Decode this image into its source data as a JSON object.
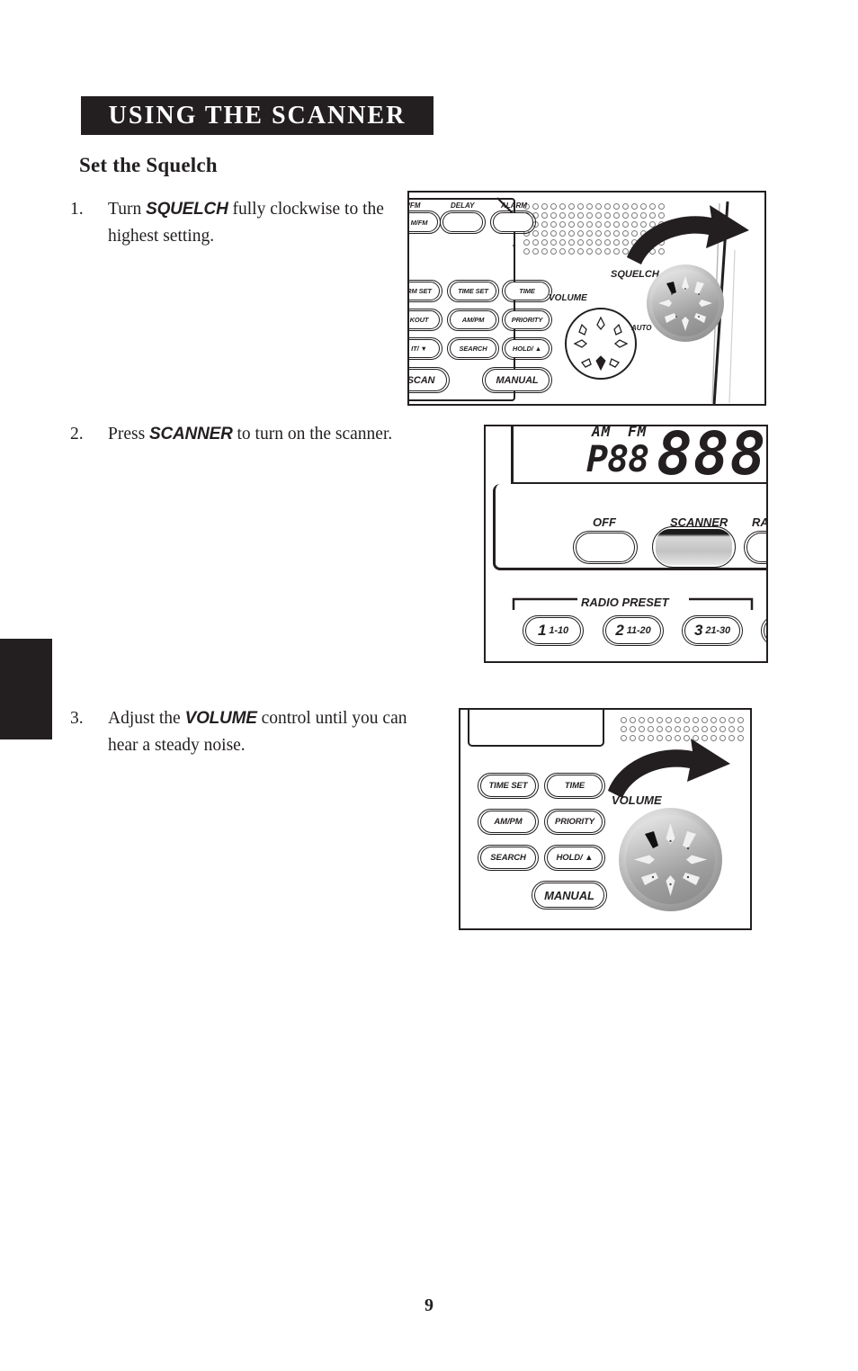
{
  "page": {
    "chapter_title": "USING THE SCANNER",
    "section_heading": "Set the Squelch",
    "page_number": "9"
  },
  "steps": [
    {
      "number": "1.",
      "text_before": "Turn ",
      "keyword": "SQUELCH",
      "text_after": " fully clockwise to the highest setting."
    },
    {
      "number": "2.",
      "text_before": "Press ",
      "keyword": "SCANNER",
      "text_after": " to turn on the scanner."
    },
    {
      "number": "3.",
      "text_before": "Adjust the ",
      "keyword": "VOLUME",
      "text_after": " control until you can hear a steady noise."
    }
  ],
  "figure1": {
    "caption_role": "squelch-knob-clockwise",
    "top_buttons": [
      "M/FM",
      "DELAY",
      "ALARM"
    ],
    "keypad": [
      [
        "RM SET",
        "TIME SET",
        "TIME"
      ],
      [
        "KOUT",
        "AM/PM",
        "PRIORITY"
      ],
      [
        "IT/ ▼",
        "SEARCH",
        "HOLD/ ▲"
      ]
    ],
    "bottom_buttons": [
      "SCAN",
      "MANUAL"
    ],
    "volume_label": "VOLUME",
    "squelch_label": "SQUELCH",
    "auto_label": "AUTO",
    "arrow": "clockwise-sweep-arrow"
  },
  "figure2": {
    "caption_role": "scanner-power-button",
    "lcd": {
      "indicator_am": "AM",
      "indicator_fm": "FM",
      "preset_text": "P88",
      "digits": "888"
    },
    "power_buttons": [
      "OFF",
      "SCANNER",
      "RAD"
    ],
    "highlighted_button": "SCANNER",
    "preset_group_label": "RADIO PRESET",
    "presets": [
      {
        "number": "1",
        "range": "1-10"
      },
      {
        "number": "2",
        "range": "11-20"
      },
      {
        "number": "3",
        "range": "21-30"
      }
    ]
  },
  "figure3": {
    "caption_role": "volume-knob-clockwise",
    "keypad": [
      [
        "TIME SET",
        "TIME"
      ],
      [
        "AM/PM",
        "PRIORITY"
      ],
      [
        "SEARCH",
        "HOLD/ ▲"
      ]
    ],
    "bottom_button": "MANUAL",
    "volume_label": "VOLUME",
    "arrow": "clockwise-sweep-arrow"
  },
  "colors": {
    "ink": "#231f20",
    "paper": "#ffffff",
    "knob_grey": "#a9a9a9",
    "highlight_grey": "#c8c8c8"
  }
}
